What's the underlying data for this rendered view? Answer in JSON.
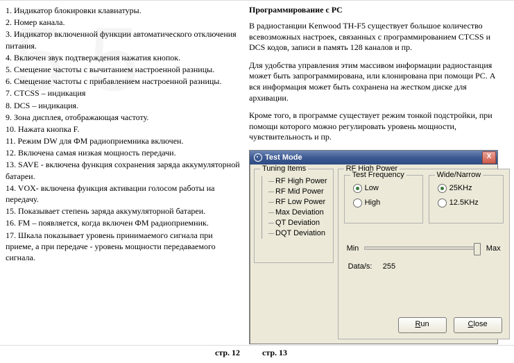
{
  "left": {
    "items": [
      "1. Индикатор блокировки клавиатуры.",
      "2. Номер канала.",
      "3. Индикатор включенной функции автоматического отключения питания.",
      "4. Включен звук подтверждения нажатия кнопок.",
      "5. Смещение частоты с вычитанием настроенной разницы.",
      "6. Смещение частоты с прибавлением настроенной разницы.",
      "7. CTCSS – индикация",
      "8. DCS – индикация.",
      "9. Зона дисплея, отображающая частоту.",
      "10. Нажата кнопка F.",
      "11. Режим DW для ФМ радиоприемника включен.",
      "12. Включена самая низкая мощность передачи.",
      "13. SAVE - включена функция сохранения заряда аккумуляторной батареи.",
      "14. VOX- включена функция активации голосом работы на передачу.",
      "15. Показывает степень заряда аккумуляторной батареи.",
      "16. FM – появляется, когда включен ФМ радиоприемник.",
      "17. Шкала показывает уровень принимаемого сигнала при приеме, а при передаче - уровень мощности передаваемого сигнала."
    ]
  },
  "right": {
    "heading": "Программирование с PC",
    "p1": "В радиостанции Kenwood TH-F5 существует большое количество всевозможных настроек, связанных с программированием CTCSS и DCS кодов, записи в память 128 каналов и пр.",
    "p2": "Для удобства управления этим массивом информации радиостанция может быть запрограммирована, или клонирована при помощи PC. А вся информация может быть сохранена на жестком диске для архивации.",
    "p3": "Кроме того, в программе существует режим тонкой подстройки, при помощи которого можно регулировать уровень мощности, чувствительность и пр."
  },
  "dialog": {
    "title": "Test Mode",
    "tuning": {
      "legend": "Tuning Items",
      "items": [
        "RF High Power",
        "RF Mid Power",
        "RF Low Power",
        "Max Deviation",
        "QT Deviation",
        "DQT Deviation"
      ]
    },
    "rf": {
      "legend": "RF High Power",
      "tf": {
        "legend": "Test Frequency",
        "low": "Low",
        "high": "High",
        "selected": "low"
      },
      "wn": {
        "legend": "Wide/Narrow",
        "w": "25KHz",
        "n": "12.5KHz",
        "selected": "w"
      },
      "slider": {
        "min": "Min",
        "max": "Max"
      },
      "data_label": "Data/s:",
      "data_value": "255"
    },
    "buttons": {
      "run": "Run",
      "close": "Close"
    }
  },
  "pages": {
    "left": "стр. 12",
    "right": "стр. 13"
  }
}
